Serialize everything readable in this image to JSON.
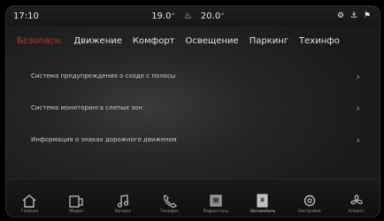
{
  "status": {
    "time": "17:10",
    "temp_left": "19.0",
    "temp_right": "20.0",
    "right_icons": "⚙ ⚓ ⚑"
  },
  "tabs": [
    {
      "label": "Безопасн.",
      "active": true
    },
    {
      "label": "Движение",
      "active": false
    },
    {
      "label": "Комфорт",
      "active": false
    },
    {
      "label": "Освещение",
      "active": false
    },
    {
      "label": "Паркинг",
      "active": false
    },
    {
      "label": "Техинфо",
      "active": false
    }
  ],
  "list": [
    {
      "label": "Система предупреждения о сходе с полосы"
    },
    {
      "label": "Система мониторинга слепых зон"
    },
    {
      "label": "Информация о знаках дорожного движения"
    }
  ],
  "nav": [
    {
      "label": "Главная",
      "icon": "home-icon"
    },
    {
      "label": "Медиа",
      "icon": "media-icon"
    },
    {
      "label": "Музыка",
      "icon": "music-icon"
    },
    {
      "label": "Телефон",
      "icon": "phone-icon"
    },
    {
      "label": "Радиостанц.",
      "icon": "radio-icon"
    },
    {
      "label": "Автомобиль",
      "icon": "car-icon",
      "active": true
    },
    {
      "label": "Настройки",
      "icon": "settings-icon"
    },
    {
      "label": "Климат",
      "icon": "climate-icon"
    }
  ],
  "colors": {
    "active_tab": "#9e3030",
    "background": "#262626"
  }
}
